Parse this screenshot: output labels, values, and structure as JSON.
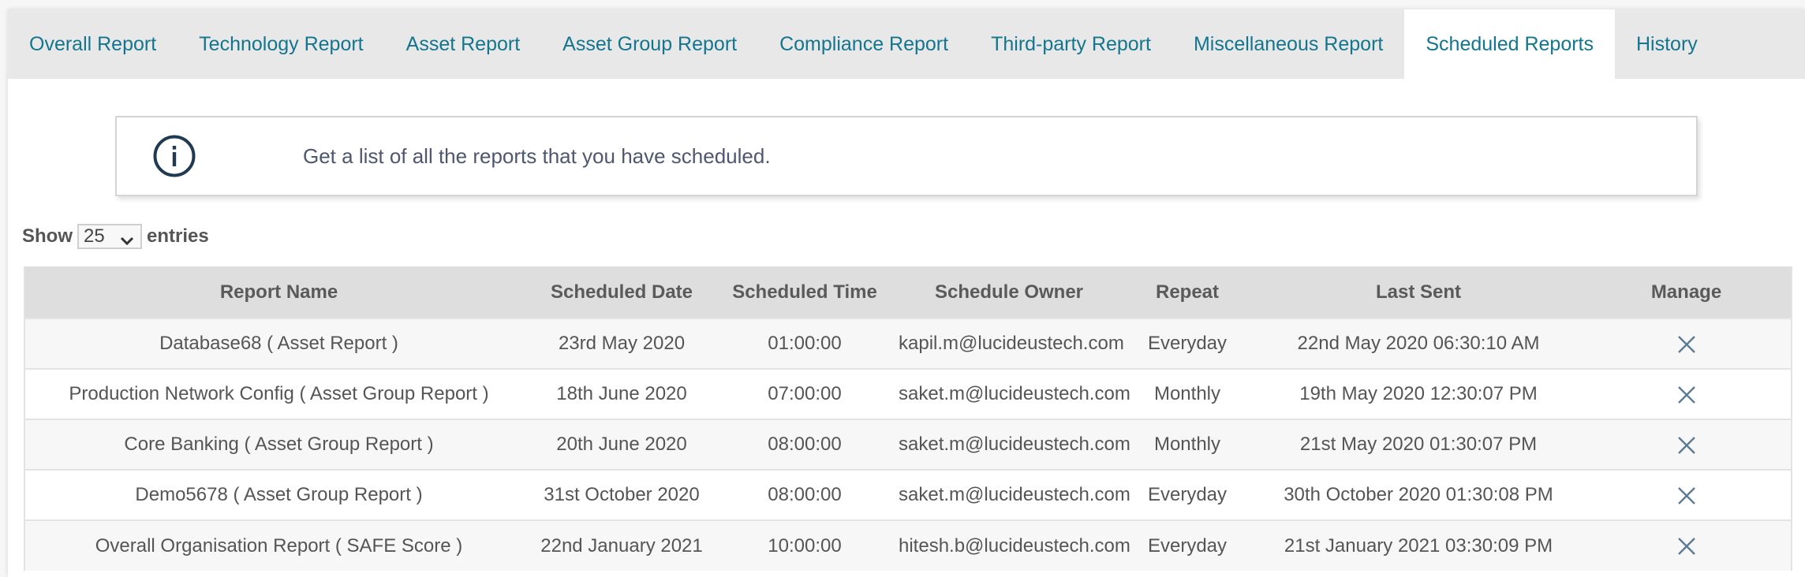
{
  "tabs": [
    {
      "label": "Overall Report",
      "active": false
    },
    {
      "label": "Technology Report",
      "active": false
    },
    {
      "label": "Asset Report",
      "active": false
    },
    {
      "label": "Asset Group Report",
      "active": false
    },
    {
      "label": "Compliance Report",
      "active": false
    },
    {
      "label": "Third-party Report",
      "active": false
    },
    {
      "label": "Miscellaneous Report",
      "active": false
    },
    {
      "label": "Scheduled Reports",
      "active": true
    },
    {
      "label": "History",
      "active": false
    }
  ],
  "info": {
    "icon": "info-circle-icon",
    "text": "Get a list of all the reports that you have scheduled."
  },
  "length_menu": {
    "prefix": "Show",
    "selected": "25",
    "suffix": "entries"
  },
  "table": {
    "columns": [
      "Report Name",
      "Scheduled Date",
      "Scheduled Time",
      "Schedule Owner",
      "Repeat",
      "Last Sent",
      "Manage"
    ],
    "rows": [
      {
        "report_name": "Database68 ( Asset Report )",
        "scheduled_date": "23rd May 2020",
        "scheduled_time": "01:00:00",
        "owner": "kapil.m@lucideustech.com",
        "repeat": "Everyday",
        "last_sent": "22nd May 2020 06:30:10 AM",
        "manage_icon": "delete-x-icon"
      },
      {
        "report_name": "Production Network Config ( Asset Group Report )",
        "scheduled_date": "18th June 2020",
        "scheduled_time": "07:00:00",
        "owner": "saket.m@lucideustech.com",
        "repeat": "Monthly",
        "last_sent": "19th May 2020 12:30:07 PM",
        "manage_icon": "delete-x-icon"
      },
      {
        "report_name": "Core Banking ( Asset Group Report )",
        "scheduled_date": "20th June 2020",
        "scheduled_time": "08:00:00",
        "owner": "saket.m@lucideustech.com",
        "repeat": "Monthly",
        "last_sent": "21st May 2020 01:30:07 PM",
        "manage_icon": "delete-x-icon"
      },
      {
        "report_name": "Demo5678 ( Asset Group Report )",
        "scheduled_date": "31st October 2020",
        "scheduled_time": "08:00:00",
        "owner": "saket.m@lucideustech.com",
        "repeat": "Everyday",
        "last_sent": "30th October 2020 01:30:08 PM",
        "manage_icon": "delete-x-icon"
      },
      {
        "report_name": "Overall Organisation Report ( SAFE Score )",
        "scheduled_date": "22nd January 2021",
        "scheduled_time": "10:00:00",
        "owner": "hitesh.b@lucideustech.com",
        "repeat": "Everyday",
        "last_sent": "21st January 2021 03:30:09 PM",
        "manage_icon": "delete-x-icon"
      }
    ]
  },
  "colors": {
    "tab_text": "#14758e",
    "tabbar_bg": "#e8e8e8",
    "header_bg": "#dedede",
    "info_icon": "#1f3a52",
    "delete_icon": "#5b7a93"
  }
}
